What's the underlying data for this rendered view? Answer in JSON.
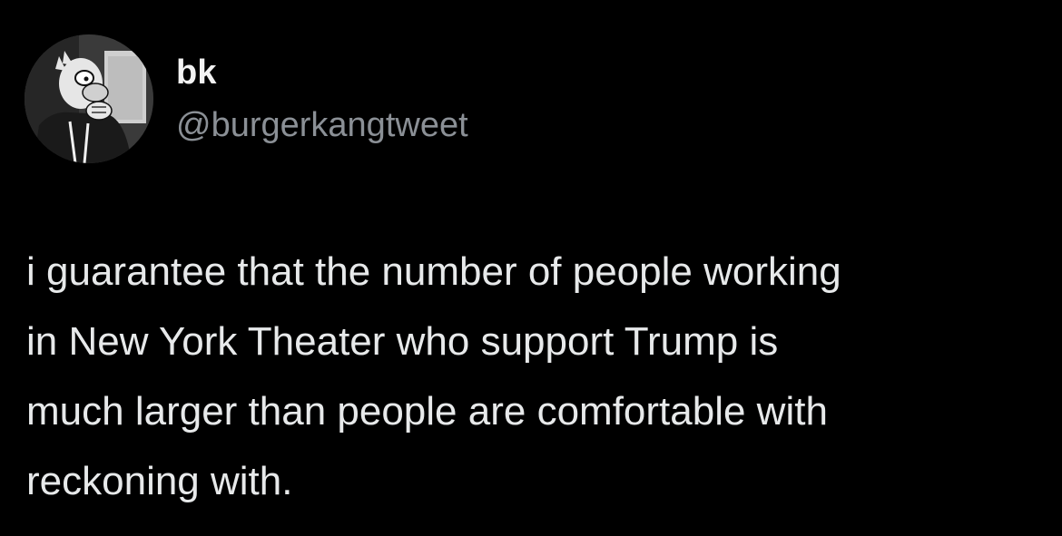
{
  "author": {
    "display_name": "bk",
    "handle": "@burgerkangtweet",
    "avatar_icon": "cartoon-character-avatar-icon"
  },
  "tweet": {
    "lines": [
      "i guarantee that the number of people working",
      "in New York Theater who support Trump is",
      "much larger than people are comfortable with",
      "reckoning with."
    ]
  },
  "colors": {
    "background": "#000000",
    "text": "#e7e9ea",
    "handle": "#8b9096"
  }
}
